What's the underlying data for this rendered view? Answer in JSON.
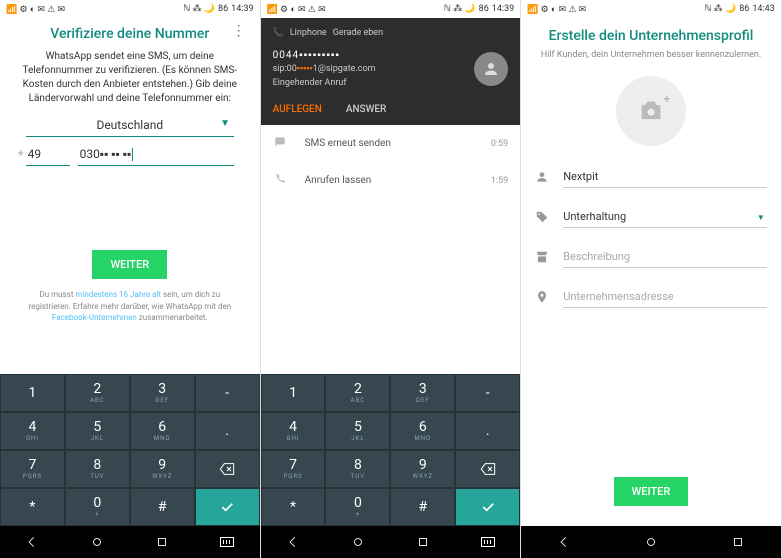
{
  "status": {
    "time1": "14:39",
    "time2": "14:39",
    "time3": "14:43",
    "battery": "86"
  },
  "s1": {
    "title": "Verifiziere deine Nummer",
    "desc": "WhatsApp sendet eine SMS, um deine Telefonnummer zu verifizieren. (Es können SMS-Kosten durch den Anbieter entstehen.) Gib deine Ländervorwahl und deine Telefonnummer ein:",
    "country": "Deutschland",
    "cc": "49",
    "num": "030▪▪ ▪▪ ▪▪",
    "btn": "WEITER",
    "legal1": "Du musst ",
    "legal2": "mindestens 16 Jahre alt",
    "legal3": " sein, um dich zu registrieren. Erfahre mehr darüber, wie WhatsApp mit den ",
    "legal4": "Facebook-Unternehmen",
    "legal5": " zusammenarbeitet."
  },
  "keys": [
    {
      "n": "1",
      "s": ""
    },
    {
      "n": "2",
      "s": "ABC"
    },
    {
      "n": "3",
      "s": "DEF"
    },
    {
      "n": "-",
      "s": "",
      "back": true
    },
    {
      "n": "4",
      "s": "GHI"
    },
    {
      "n": "5",
      "s": "JKL"
    },
    {
      "n": "6",
      "s": "MNO"
    },
    {
      "n": ".",
      "s": ""
    },
    {
      "n": "7",
      "s": "PQRS"
    },
    {
      "n": "8",
      "s": "TUV"
    },
    {
      "n": "9",
      "s": "WXYZ"
    },
    {
      "n": "",
      "s": "",
      "back": true,
      "icon": "back"
    },
    {
      "n": "*",
      "s": ""
    },
    {
      "n": "0",
      "s": "+"
    },
    {
      "n": "#",
      "s": ""
    },
    {
      "n": "",
      "s": "",
      "check": true,
      "icon": "check"
    }
  ],
  "s2": {
    "linphone": "Linphone",
    "linphone_sub": "Gerade eben",
    "num": "0044▪▪▪▪▪▪▪▪▪",
    "sip_prefix": "sip:00",
    "sip_mid": "▪▪▪▪▪",
    "sip_suffix": "1@sipgate.com",
    "status": "Eingehender Anruf",
    "auflegen": "AUFLEGEN",
    "answer": "ANSWER",
    "items": [
      {
        "icon": "sms",
        "txt": "SMS erneut senden",
        "time": "0:59"
      },
      {
        "icon": "call",
        "txt": "Anrufen lassen",
        "time": "1:59"
      }
    ]
  },
  "s3": {
    "title": "Erstelle dein Unternehmensprofil",
    "sub": "Hilf Kunden, dein Unternehmen besser kennenzulernen.",
    "name": "Nextpit",
    "category": "Unterhaltung",
    "desc_ph": "Beschreibung",
    "addr_ph": "Unternehmensadresse",
    "btn": "WEITER"
  }
}
